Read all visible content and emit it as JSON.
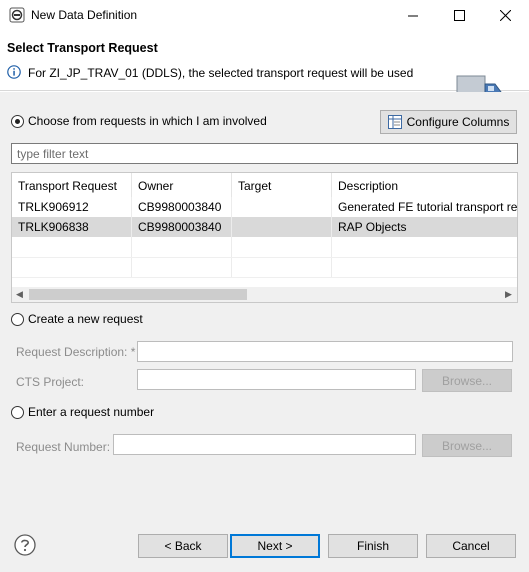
{
  "window": {
    "title": "New Data Definition",
    "icons": {
      "app": "eclipse-app-icon",
      "minimize": "minimize-icon",
      "maximize": "maximize-icon",
      "close": "close-icon"
    }
  },
  "header": {
    "title": "Select Transport Request",
    "message": "For ZI_JP_TRAV_01 (DDLS), the selected transport request will be used",
    "icons": {
      "info": "info-icon",
      "banner": "transport-truck-icon"
    }
  },
  "choose_involved": {
    "label": "Choose from requests in which I am involved",
    "selected": true
  },
  "configure_columns": {
    "label": "Configure Columns",
    "icon": "columns-icon"
  },
  "filter": {
    "placeholder": "type filter text",
    "value": ""
  },
  "table": {
    "columns": [
      "Transport Request",
      "Owner",
      "Target",
      "Description"
    ],
    "rows": [
      {
        "request": "TRLK906912",
        "owner": "CB9980003840",
        "target": "",
        "description": "Generated FE tutorial transport request"
      },
      {
        "request": "TRLK906838",
        "owner": "CB9980003840",
        "target": "",
        "description": "RAP Objects"
      }
    ],
    "selected_row": 1,
    "scroll_icons": {
      "left": "scroll-left-icon",
      "right": "scroll-right-icon"
    }
  },
  "create_new": {
    "label": "Create a new request",
    "selected": false,
    "description_label": "Request Description: *",
    "description_value": "",
    "cts_label": "CTS Project:",
    "cts_value": "",
    "browse_label": "Browse..."
  },
  "enter_number": {
    "label": "Enter a request number",
    "selected": false,
    "number_label": "Request Number:",
    "number_value": "",
    "browse_label": "Browse..."
  },
  "footer": {
    "help_icon": "help-icon",
    "back": "< Back",
    "next": "Next >",
    "finish": "Finish",
    "cancel": "Cancel"
  }
}
